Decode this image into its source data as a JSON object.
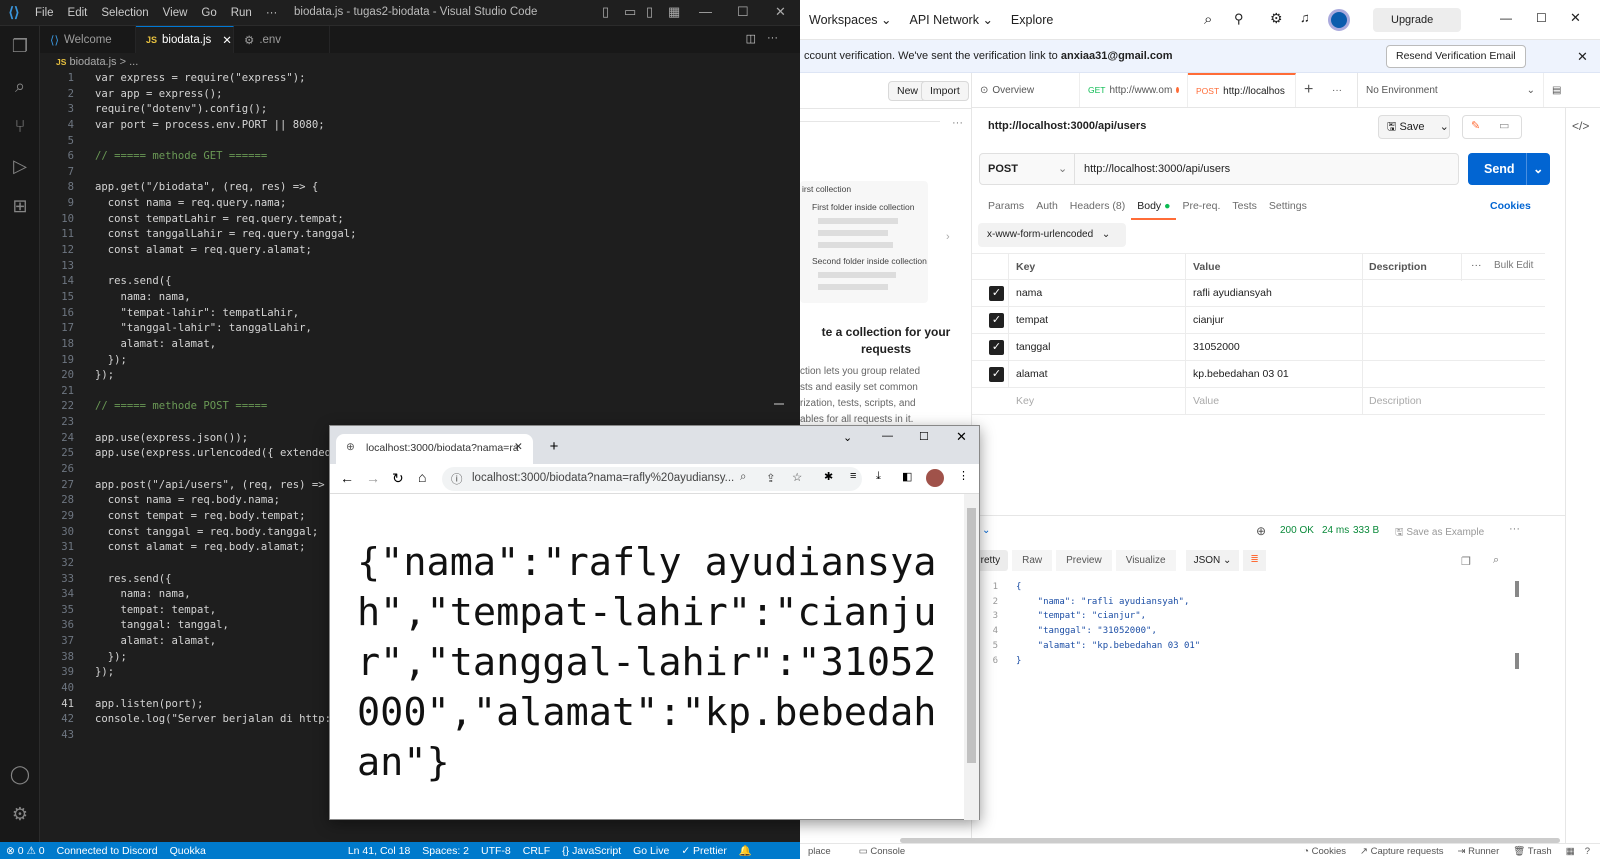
{
  "vscode": {
    "menu": [
      "File",
      "Edit",
      "Selection",
      "View",
      "Go",
      "Run",
      "···"
    ],
    "window_title": "biodata.js - tugas2-biodata - Visual Studio Code",
    "tabs": [
      "Welcome",
      "biodata.js",
      ".env"
    ],
    "breadcrumb": "biodata.js > ...",
    "file_icon": "JS",
    "code": [
      "var express = require(\"express\");",
      "var app = express();",
      "require(\"dotenv\").config();",
      "var port = process.env.PORT || 8080;",
      "",
      "// ===== methode GET ======",
      "",
      "app.get(\"/biodata\", (req, res) => {",
      "  const nama = req.query.nama;",
      "  const tempatLahir = req.query.tempat;",
      "  const tanggalLahir = req.query.tanggal;",
      "  const alamat = req.query.alamat;",
      "",
      "  res.send({",
      "    nama: nama,",
      "    \"tempat-lahir\": tempatLahir,",
      "    \"tanggal-lahir\": tanggalLahir,",
      "    alamat: alamat,",
      "  });",
      "});",
      "",
      "// ===== methode POST =====",
      "",
      "app.use(express.json());",
      "app.use(express.urlencoded({ extended",
      "",
      "app.post(\"/api/users\", (req, res) =>",
      "  const nama = req.body.nama;",
      "  const tempat = req.body.tempat;",
      "  const tanggal = req.body.tanggal;",
      "  const alamat = req.body.alamat;",
      "",
      "  res.send({",
      "    nama: nama,",
      "    tempat: tempat,",
      "    tanggal: tanggal,",
      "    alamat: alamat,",
      "  });",
      "});",
      "",
      "app.listen(port);",
      "console.log(\"Server berjalan di http:",
      ""
    ],
    "current_line": 41,
    "status": {
      "problems": "⊗ 0 ⚠ 0",
      "discord": "Connected to Discord",
      "quokka": "Quokka",
      "position": "Ln 41, Col 18",
      "spaces": "Spaces: 2",
      "encoding": "UTF-8",
      "eol": "CRLF",
      "language": "{} JavaScript",
      "golive": "Go Live",
      "prettier": "✓ Prettier"
    }
  },
  "postman": {
    "nav": [
      "Workspaces",
      "API Network",
      "Explore"
    ],
    "upgrade": "Upgrade",
    "banner": "ccount verification. We've sent the verification link to",
    "banner_email": "anxiaa31@gmail.com",
    "resend": "Resend Verification Email",
    "left": {
      "new": "New",
      "import": "Import",
      "collection_title": "irst collection",
      "folder1": "First folder inside collection",
      "folder2": "Second folder inside collection",
      "heading1": "te a collection for your",
      "heading2": "requests",
      "body": [
        "ction lets you group related",
        "sts and easily set common",
        "rization, tests, scripts, and",
        "ables for all requests in it."
      ],
      "bottom": "place",
      "console": "Console"
    },
    "tabs": [
      {
        "label": "Overview"
      },
      {
        "method": "GET",
        "label": "http://www.om"
      },
      {
        "method": "POST",
        "label": "http://localhos"
      }
    ],
    "environment": "No Environment",
    "request_name": "http://localhost:3000/api/users",
    "save": "Save",
    "method": "POST",
    "url": "http://localhost:3000/api/users",
    "send": "Send",
    "req_tabs": [
      "Params",
      "Auth",
      "Headers (8)",
      "Body",
      "Pre-req.",
      "Tests",
      "Settings"
    ],
    "cookies": "Cookies",
    "body_type": "x-www-form-urlencoded",
    "kv_headers": {
      "key": "Key",
      "value": "Value",
      "description": "Description",
      "bulk": "Bulk Edit"
    },
    "kv": [
      {
        "key": "nama",
        "value": "rafli ayudiansyah"
      },
      {
        "key": "tempat",
        "value": "cianjur"
      },
      {
        "key": "tanggal",
        "value": "31052000"
      },
      {
        "key": "alamat",
        "value": "kp.bebedahan 03 01"
      }
    ],
    "kv_placeholder": {
      "key": "Key",
      "value": "Value",
      "description": "Description"
    },
    "response": {
      "body_label": "ly",
      "status": "200 OK",
      "time": "24 ms",
      "size": "333 B",
      "save_example": "Save as Example",
      "views": [
        "Pretty",
        "Raw",
        "Preview",
        "Visualize"
      ],
      "format": "JSON",
      "lines": [
        "{",
        "    \"nama\": \"rafli ayudiansyah\",",
        "    \"tempat\": \"cianjur\",",
        "    \"tanggal\": \"31052000\",",
        "    \"alamat\": \"kp.bebedahan 03 01\"",
        "}"
      ]
    },
    "statusbar": [
      "Cookies",
      "Capture requests",
      "Runner",
      "Trash"
    ]
  },
  "chrome": {
    "tab_title": "localhost:3000/biodata?nama=ra",
    "url": "localhost:3000/biodata?nama=rafly%20ayudiansy...",
    "content": "{\"nama\":\"rafly ayudiansyah\",\"tempat-lahir\":\"cianjur\",\"tanggal-lahir\":\"31052000\",\"alamat\":\"kp.bebedahan\"}"
  },
  "colors": {
    "vscode_blue": "#007acc",
    "postman_orange": "#ff6c37",
    "send_blue": "#0265d2"
  }
}
